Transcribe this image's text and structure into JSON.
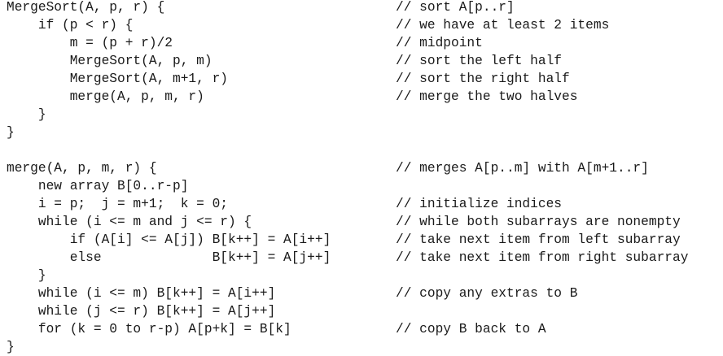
{
  "code_lines": [
    {
      "code": "MergeSort(A, p, r) {",
      "comment": "// sort A[p..r]"
    },
    {
      "code": "    if (p < r) {",
      "comment": "// we have at least 2 items"
    },
    {
      "code": "        m = (p + r)/2",
      "comment": "// midpoint"
    },
    {
      "code": "        MergeSort(A, p, m)",
      "comment": "// sort the left half"
    },
    {
      "code": "        MergeSort(A, m+1, r)",
      "comment": "// sort the right half"
    },
    {
      "code": "        merge(A, p, m, r)",
      "comment": "// merge the two halves"
    },
    {
      "code": "    }",
      "comment": ""
    },
    {
      "code": "}",
      "comment": ""
    },
    {
      "code": "",
      "comment": ""
    },
    {
      "code": "merge(A, p, m, r) {",
      "comment": "// merges A[p..m] with A[m+1..r]"
    },
    {
      "code": "    new array B[0..r-p]",
      "comment": ""
    },
    {
      "code": "    i = p;  j = m+1;  k = 0;",
      "comment": "// initialize indices"
    },
    {
      "code": "    while (i <= m and j <= r) {",
      "comment": "// while both subarrays are nonempty"
    },
    {
      "code": "        if (A[i] <= A[j]) B[k++] = A[i++]",
      "comment": "// take next item from left subarray"
    },
    {
      "code": "        else              B[k++] = A[j++]",
      "comment": "// take next item from right subarray"
    },
    {
      "code": "    }",
      "comment": ""
    },
    {
      "code": "    while (i <= m) B[k++] = A[i++]",
      "comment": "// copy any extras to B"
    },
    {
      "code": "    while (j <= r) B[k++] = A[j++]",
      "comment": ""
    },
    {
      "code": "    for (k = 0 to r-p) A[p+k] = B[k]",
      "comment": "// copy B back to A"
    },
    {
      "code": "}",
      "comment": ""
    }
  ]
}
